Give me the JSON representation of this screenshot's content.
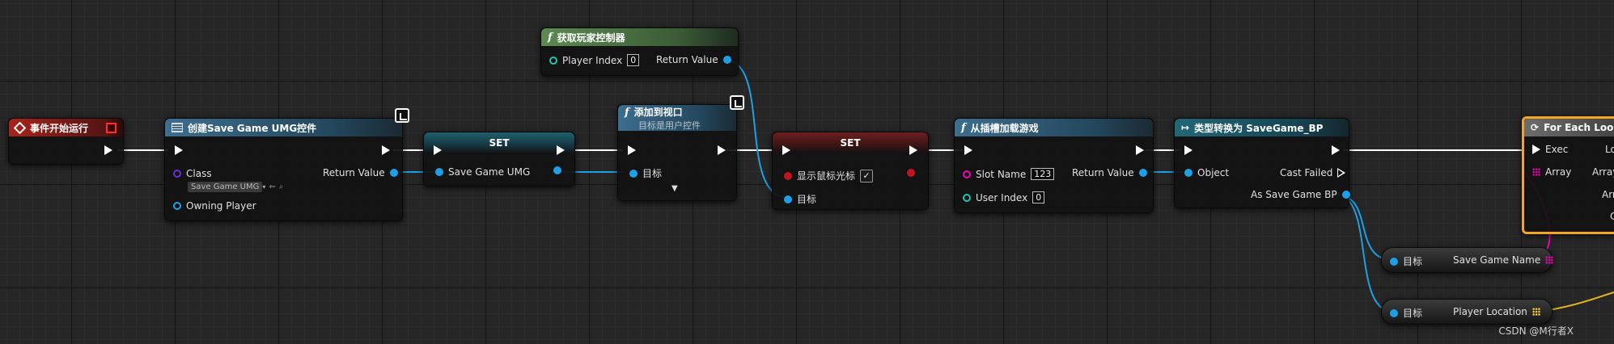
{
  "nodes": {
    "event_begin": {
      "title": "事件开始运行"
    },
    "create_widget": {
      "title": "创建Save Game UMG控件",
      "class_label": "Class",
      "class_value": "Save Game UMG",
      "return_label": "Return Value",
      "owning_label": "Owning Player"
    },
    "set_umg": {
      "title": "SET",
      "var_label": "Save Game UMG"
    },
    "get_player_controller": {
      "title": "获取玩家控制器",
      "player_index_label": "Player Index",
      "player_index_value": "0",
      "return_label": "Return Value"
    },
    "add_to_viewport": {
      "title": "添加到视口",
      "subtitle": "目标是用户控件",
      "target_label": "目标"
    },
    "set_cursor": {
      "title": "SET",
      "show_cursor_label": "显示鼠标光标",
      "target_label": "目标",
      "checked": "✓"
    },
    "load_game": {
      "title": "从插槽加载游戏",
      "slot_label": "Slot Name",
      "slot_value": "123",
      "return_label": "Return Value",
      "user_index_label": "User Index",
      "user_index_value": "0"
    },
    "cast": {
      "title": "类型转换为 SaveGame_BP",
      "object_label": "Object",
      "cast_failed_label": "Cast Failed",
      "as_label": "As Save Game BP"
    },
    "for_each": {
      "title": "For Each Loop",
      "exec_label": "Exec",
      "array_label": "Array",
      "out1": "Lo",
      "out2": "Array",
      "out3": "Arr",
      "out4": "C"
    },
    "get_save_name": {
      "target_label": "目标",
      "var_label": "Save Game Name"
    },
    "get_player_loc": {
      "target_label": "目标",
      "var_label": "Player Location"
    }
  },
  "watermark": "CSDN @M行者X",
  "colors": {
    "exec": "#ffffff",
    "object_pin": "#1da0e6",
    "bool_pin": "#c0151f",
    "string_pin": "#f200b8",
    "vector_pin": "#ffd83b",
    "int_pin": "#1fc5b5",
    "class_pin": "#6d2ed8"
  }
}
